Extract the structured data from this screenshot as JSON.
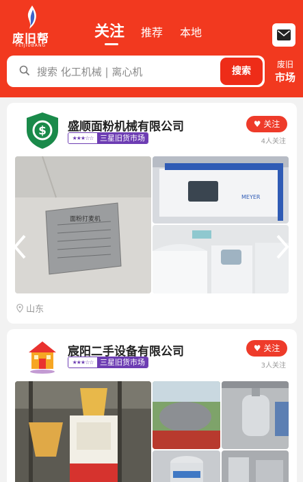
{
  "brand": {
    "logo_text": "废旧帮",
    "logo_sub": "FEIJIUBANG"
  },
  "tabs": [
    "关注",
    "推荐",
    "本地"
  ],
  "search": {
    "placeholder": "搜索 化工机械 | 离心机",
    "button": "搜索"
  },
  "market_link": {
    "line1": "废旧",
    "line2": "市场"
  },
  "cards": [
    {
      "name": "盛顺面粉机械有限公司",
      "stars": "★★★☆☆",
      "badge": "三星旧货市场",
      "follow": "关注",
      "followers": "4人关注",
      "location": "山东",
      "plate_text": "面粉打麦机"
    },
    {
      "name": "宸阳二手设备有限公司",
      "stars": "★★★☆☆",
      "badge": "三星旧货市场",
      "follow": "关注",
      "followers": "3人关注"
    }
  ],
  "icons": {
    "message": "mail-icon",
    "search": "search-icon",
    "heart": "heart-icon",
    "location": "location-pin-icon",
    "prev": "chevron-left-icon",
    "next": "chevron-right-icon"
  },
  "colors": {
    "brand_red": "#f2391f",
    "badge_purple": "#6d3db3",
    "shield_green": "#1a8a4a"
  }
}
